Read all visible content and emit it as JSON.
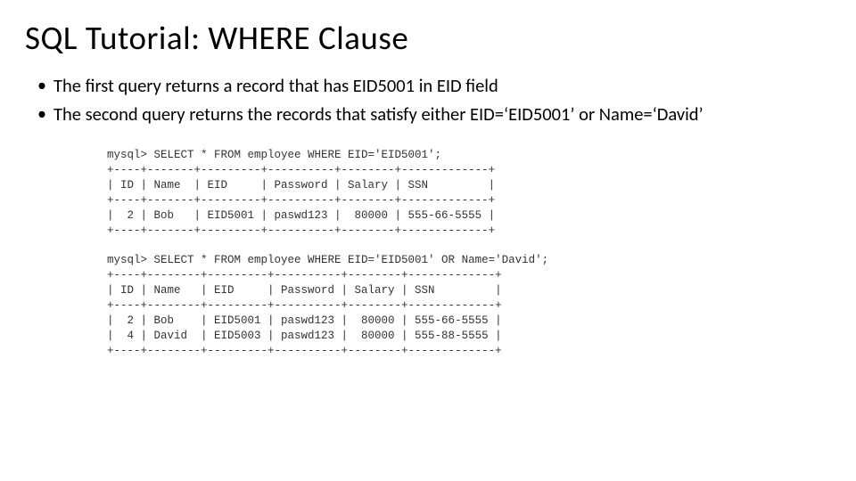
{
  "title": "SQL Tutorial: WHERE Clause",
  "bullets": [
    "The first query returns a record that has EID5001 in EID field",
    "The second query returns the records that satisfy either EID=‘EID5001’ or Name=‘David’"
  ],
  "terminal": {
    "query1_line": "mysql> SELECT * FROM employee WHERE EID='EID5001';",
    "border1": "+----+-------+---------+----------+--------+-------------+",
    "header1": "| ID | Name  | EID     | Password | Salary | SSN         |",
    "row1": "|  2 | Bob   | EID5001 | paswd123 |  80000 | 555-66-5555 |",
    "query2_line": "mysql> SELECT * FROM employee WHERE EID='EID5001' OR Name='David';",
    "border2": "+----+--------+---------+----------+--------+-------------+",
    "header2": "| ID | Name   | EID     | Password | Salary | SSN         |",
    "row2a": "|  2 | Bob    | EID5001 | paswd123 |  80000 | 555-66-5555 |",
    "row2b": "|  4 | David  | EID5003 | paswd123 |  80000 | 555-88-5555 |"
  }
}
